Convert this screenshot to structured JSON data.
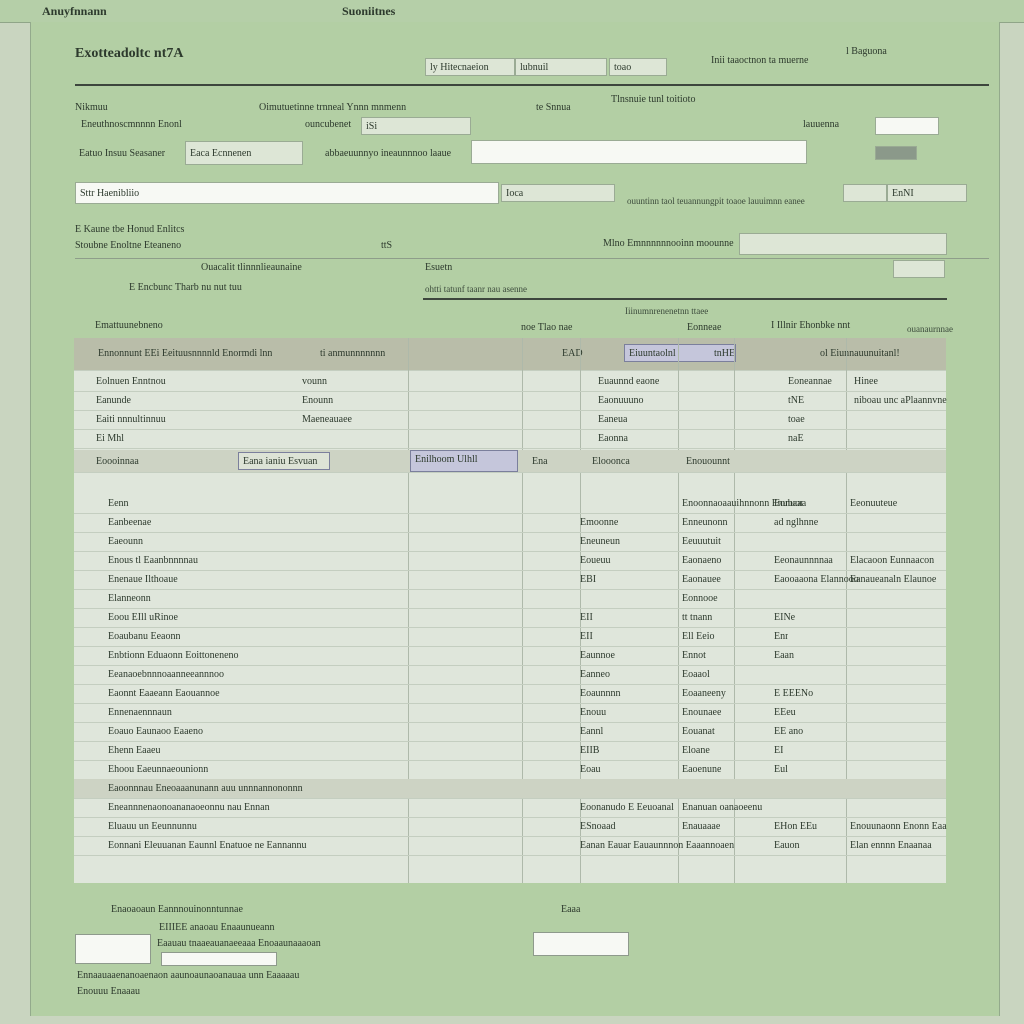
{
  "topbar": {
    "left": "Anuyfnnann",
    "center": "Suoniitnes"
  },
  "header": {
    "title": "Exotteadoltc nt7A",
    "field1_label": "ly Hitecnaeion",
    "field1_value": "lubnuil",
    "field1_suffix": "toao",
    "right_label": "Inii taaoctnon ta muerne",
    "corner_label": "l Baguona"
  },
  "section1": {
    "label_a": "Nikmuu",
    "label_b": "Oimutuetinne trnneal Ynnn mnmenn",
    "label_c": "te Snnua",
    "label_d": "Tlnsnuie tunl toitioto",
    "row2_label": "Eneuthnoscmnnnn Enonl",
    "row2_mid": "ouncubenet",
    "row2_val": "iSi",
    "row2_right": "lauuenna",
    "row3_label": "Eatuo Insuu Seasaner",
    "row3_field": "Eaca Ecnnenen",
    "row3_mid": "abbaeuunnyo ineaunnnoo laaue",
    "search_value": "Sttr Haenibliio",
    "search_btn": "Ioca",
    "search_note": "ouuntinn taol teuannungpit toaoe lauuimnn eanee",
    "search_right": "EnNI"
  },
  "section2": {
    "label_a": "E Kaune tbe Honud Enlitcs",
    "label_b": "Stoubne Enoltne Eteaneno",
    "label_b_val": "ttS",
    "right_label": "Mlno Emnnnnnnooinn moounne",
    "sub_a": "Ouacalit tlinnnlieaunaine",
    "sub_b": "Esuetn",
    "sub_c": "E Encbunc Tharb nu nut tuu",
    "sub_d": "ohtti tatunf taanr nau asenne",
    "group_label": "Emattuunebneno",
    "col_head_a": "noe Tlao nae",
    "col_head_b": "Iiinumnrenenetnn ttaee",
    "col_head_c": "Eonneae",
    "col_head_d": "I Illnir  Ehonbke nnt",
    "col_head_e": "ouanaurnnae"
  },
  "table": {
    "header_row": [
      "Ennonnunt EEi Eeituusnnnnld Enormdi lnn",
      "ti anmunnnnnnn",
      "EAD",
      "Eiuuntaolnl",
      "tnHE",
      "ol Eiunnauunuitanl!"
    ],
    "top_rows": [
      {
        "a": "Eolnuen Enntnou",
        "b": "vounn",
        "c": "Euaunnd  eaone",
        "d": "Eoneannae",
        "e": "Hinee"
      },
      {
        "a": "Eanunde",
        "b": "Enounn",
        "c": "Eaonuuuno",
        "d": "tNE",
        "e": "niboau unc aPlaannvne"
      },
      {
        "a": "Eaiti nnnultinnuu",
        "b": "Maeneauaee",
        "c": "Eaneua",
        "d": "toae",
        "e": ""
      },
      {
        "a": "Ei Mhl",
        "b": "",
        "c": "Eaonna",
        "d": "naE",
        "e": ""
      }
    ],
    "band_row": {
      "a": "Eoooinnaa",
      "b": "Eana ianiu Esvuan",
      "c": "Enilhoom Ulhll",
      "d": "Ena",
      "e": "Elooonca",
      "f": "Enouounnt"
    },
    "list_rows": [
      {
        "a": "Eenn",
        "b": "",
        "c": "Enoonnaoaauihnnonn  Enubaaa",
        "d": "Eonuor",
        "e": "Eeonuuteue"
      },
      {
        "a": "Eanbeenae",
        "b": "Emoonne",
        "c": "Enneunonn",
        "d": "ad nglhnne",
        "e": ""
      },
      {
        "a": "Eaeounn",
        "b": "Eneuneun",
        "c": "Eeuuutuit",
        "d": "",
        "e": ""
      },
      {
        "a": "Enous tl Eaanbnnnnau",
        "b": "Eoueuu",
        "c": "Eaonaeno",
        "d": "Eeonaunnnnaa",
        "e": "Elacaoon Eunnaacon"
      },
      {
        "a": "Enenaue  Ilthoaue",
        "b": "EBI",
        "c": "Eaonauee",
        "d": "Eaooaaona  Elannooo",
        "e": "Eanaueanaln Elaunoe"
      },
      {
        "a": "Elanneonn",
        "b": "",
        "c": "Eonnooe",
        "d": "",
        "e": ""
      },
      {
        "a": "Eoou EIll uRinoe",
        "b": "EII",
        "c": "tt tnann",
        "d": "EINe",
        "e": ""
      },
      {
        "a": "Eoaubanu Eeaonn",
        "b": "EII",
        "c": "Ell Eeio",
        "d": "Enr",
        "e": ""
      },
      {
        "a": "Enbtionn Eduaonn Eoittoneneno",
        "b": "Eaunnoe",
        "c": "Ennot",
        "d": "Eaan",
        "e": ""
      },
      {
        "a": "Eeanaoebnnnoaanneeannnoo",
        "b": "Eanneo",
        "c": "Eoaaol",
        "d": "",
        "e": ""
      },
      {
        "a": "Eaonnt Eaaeann Eaouannoe",
        "b": "Eoaunnnn",
        "c": "Eoaaneeny",
        "d": "E  EEENo",
        "e": ""
      },
      {
        "a": "Ennenaennnaun",
        "b": "Enouu",
        "c": "Enounaee",
        "d": "EEeu",
        "e": ""
      },
      {
        "a": "Eoauo Eaunaoo Eaaeno",
        "b": "Eannl",
        "c": "Eouanat",
        "d": "EE ano",
        "e": ""
      },
      {
        "a": "Ehenn Eaaeu",
        "b": "EIIB",
        "c": "Eloane",
        "d": "EI",
        "e": ""
      },
      {
        "a": "Ehoou Eaeunnaeounionn",
        "b": "Eoau",
        "c": "Eaoenune",
        "d": "Eul",
        "e": ""
      },
      {
        "a": "Eaoonnnau Eneoaaanunann  auu unnnannononnn",
        "b": "",
        "c": "",
        "d": "",
        "e": ""
      },
      {
        "a": "Eneannnenaonoananaoeonnu nau  Ennan",
        "b": "Eoonanudo E Eeuoanal",
        "c": "Enanuan oanaoeenu",
        "d": "",
        "e": ""
      },
      {
        "a": "Eluauu  un Eeunnunnu",
        "b": "ESnoaad",
        "c": "Enauaaae",
        "d": "EHon  EEu",
        "e": "Enouunaonn Enonn Eaa"
      },
      {
        "a": "Eonnani Eleuuanan  Eaunnl Enatuoe ne Eannannu",
        "b": "Eanan Eauar Eauaunnnon  Eaaannoaen",
        "c": "",
        "d": "Eauon",
        "e": "Elan ennnn Enaanaa"
      }
    ]
  },
  "footer": {
    "line1": "Enaoaoaun Eannnouinonntunnae",
    "line1_right": "Eaaa",
    "line2": "EIIIEE anaoau Enaaunueann",
    "line3": "Eaauau  tnaaeauanaeeaaa  Enoaaunaaaoan",
    "line4": "Ennaauaaenanoaenaon  aaunoaunaoanauaa unn Eaaaaau",
    "line5": "Enouuu Enaaau"
  }
}
